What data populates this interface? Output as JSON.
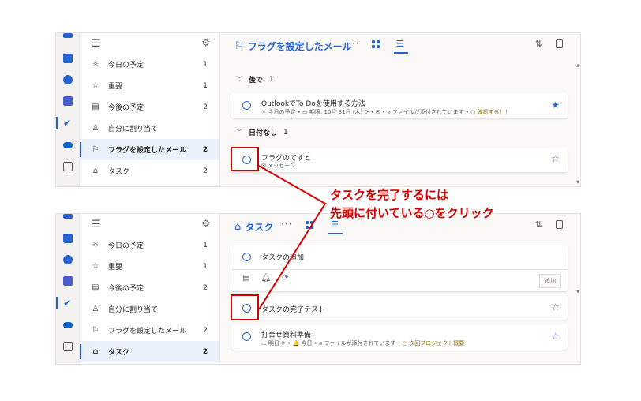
{
  "sidebar": {
    "items": [
      {
        "label": "今日の予定",
        "count": "1"
      },
      {
        "label": "重要",
        "count": "1"
      },
      {
        "label": "今後の予定",
        "count": "2"
      },
      {
        "label": "自分に割り当て",
        "count": ""
      },
      {
        "label": "フラグを設定したメール",
        "count": "2"
      },
      {
        "label": "タスク",
        "count": "2"
      }
    ]
  },
  "panel1": {
    "title": "フラグを設定したメール",
    "active_item": "フラグを設定したメール",
    "sections": [
      {
        "label": "後で",
        "count": "1"
      },
      {
        "label": "日付なし",
        "count": "1"
      }
    ],
    "tasks": [
      {
        "title": "OutlookでTo Doを使用する方法",
        "meta_a": "☼ 今日の予定 • ▭ 期限: 10月 31日 (木) ⟳ • ✉ • ⌀ ファイルが添付されています •",
        "meta_warn": "○ 確認する！！",
        "starred": "★"
      },
      {
        "title": "フラグのてすと",
        "meta_a": "✉ メッセージ",
        "meta_warn": "",
        "starred": "☆"
      }
    ]
  },
  "panel2": {
    "title": "タスク",
    "add_placeholder": "タスクの追加",
    "add_button": "追加",
    "tasks": [
      {
        "title": "タスクの完了テスト",
        "meta_a": "",
        "meta_warn": "",
        "starred": "☆"
      },
      {
        "title": "打合せ資料準備",
        "meta_a": "▭ 明日 ⟳ • 🔔 今日 • ⌀ ファイルが添付されています •",
        "meta_warn": "○ 次回プロジェクト概要",
        "starred": "☆"
      }
    ]
  },
  "callout": {
    "line1": "タスクを完了するには",
    "line2": "先頭に付いている○をクリック"
  },
  "colors": {
    "accent": "#2564cf",
    "annotation": "#d40000"
  }
}
